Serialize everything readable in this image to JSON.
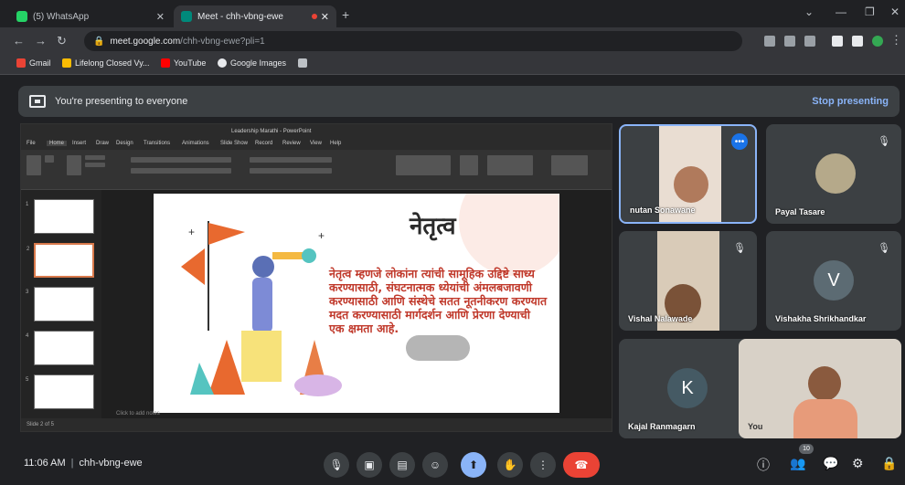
{
  "browser": {
    "tabs": [
      {
        "title": "(5) WhatsApp",
        "favicon_color": "#25d366"
      },
      {
        "title": "Meet - chh-vbng-ewe",
        "favicon_color": "#00897b"
      }
    ],
    "new_tab": "+",
    "url_domain": "meet.google.com",
    "url_path": "/chh-vbng-ewe?pli=1",
    "bookmarks": [
      {
        "label": "Gmail",
        "color": "#ea4335"
      },
      {
        "label": "Lifelong Closed Vy...",
        "color": "#fbbc04"
      },
      {
        "label": "YouTube",
        "color": "#ff0000"
      },
      {
        "label": "Google Images",
        "color": "#e8eaed"
      }
    ]
  },
  "meet": {
    "banner_text": "You're presenting to everyone",
    "stop_label": "Stop presenting",
    "meeting_time": "11:06 AM",
    "meeting_code": "chh-vbng-ewe",
    "participant_count": "10"
  },
  "presentation": {
    "window_title": "Leadership Marathi - PowerPoint",
    "menu": [
      "File",
      "Home",
      "Insert",
      "Draw",
      "Design",
      "Transitions",
      "Animations",
      "Slide Show",
      "Record",
      "Review",
      "View",
      "Help"
    ],
    "slide_title": "नेतृत्व",
    "slide_body": "नेतृत्व म्हणजे लोकांना त्यांची सामूहिक उद्दिष्टे साध्य करण्यासाठी, संघटनात्मक ध्येयांची अंमलबजावणी करण्यासाठी आणि संस्थेचे सतत नूतनीकरण करण्यात मदत करण्यासाठी मार्गदर्शन आणि प्रेरणा देण्याची एक क्षमता आहे.",
    "notes_caption": "Click to add notes",
    "status_text": "Slide 2 of 5"
  },
  "participants": [
    {
      "name": "nutan Sonawane",
      "type": "video",
      "active": true
    },
    {
      "name": "Payal Tasare",
      "type": "image"
    },
    {
      "name": "Vishal Nalawade",
      "type": "video"
    },
    {
      "name": "Vishakha Shrikhandkar",
      "type": "letter",
      "letter": "V",
      "color": "#5c6b73"
    },
    {
      "name": "Kajal Ranmagarn",
      "type": "letter",
      "letter": "K",
      "color": "#455a64"
    },
    {
      "name": "You",
      "type": "video"
    }
  ]
}
